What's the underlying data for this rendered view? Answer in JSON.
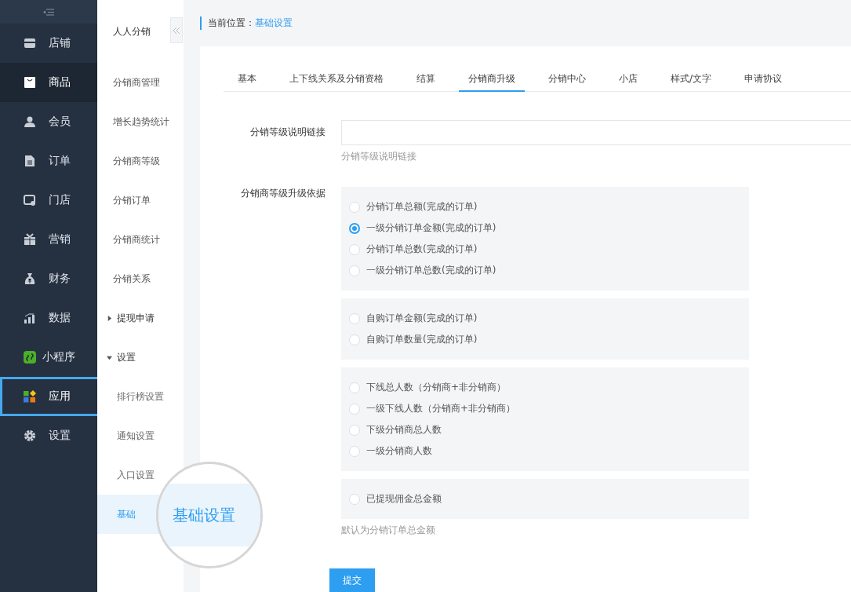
{
  "main_nav": {
    "items": [
      {
        "label": "店铺",
        "selected": false,
        "highlighted": false
      },
      {
        "label": "商品",
        "selected": true,
        "highlighted": false
      },
      {
        "label": "会员",
        "selected": false,
        "highlighted": false
      },
      {
        "label": "订单",
        "selected": false,
        "highlighted": false
      },
      {
        "label": "门店",
        "selected": false,
        "highlighted": false
      },
      {
        "label": "营销",
        "selected": false,
        "highlighted": false
      },
      {
        "label": "财务",
        "selected": false,
        "highlighted": false
      },
      {
        "label": "数据",
        "selected": false,
        "highlighted": false
      },
      {
        "label": "小程序",
        "selected": false,
        "highlighted": false
      },
      {
        "label": "应用",
        "selected": false,
        "highlighted": true
      },
      {
        "label": "设置",
        "selected": false,
        "highlighted": false
      }
    ]
  },
  "sub_nav": {
    "title": "人人分销",
    "items": [
      {
        "kind": "link",
        "label": "分销商管理",
        "selected": false
      },
      {
        "kind": "link",
        "label": "增长趋势统计",
        "selected": false
      },
      {
        "kind": "link",
        "label": "分销商等级",
        "selected": false
      },
      {
        "kind": "link",
        "label": "分销订单",
        "selected": false
      },
      {
        "kind": "link",
        "label": "分销商统计",
        "selected": false
      },
      {
        "kind": "link",
        "label": "分销关系",
        "selected": false
      },
      {
        "kind": "group",
        "label": "提现申请",
        "expanded": false
      },
      {
        "kind": "group",
        "label": "设置",
        "expanded": true,
        "children": [
          {
            "kind": "link",
            "label": "排行榜设置",
            "selected": false
          },
          {
            "kind": "link",
            "label": "通知设置",
            "selected": false
          },
          {
            "kind": "link",
            "label": "入口设置",
            "selected": false
          },
          {
            "kind": "link",
            "label": "基础",
            "selected": true
          }
        ]
      }
    ]
  },
  "magnifier": {
    "label": "基础设置"
  },
  "breadcrumb": {
    "prefix": "当前位置：",
    "current": "基础设置"
  },
  "tabs": [
    {
      "label": "基本",
      "selected": false
    },
    {
      "label": "上下线关系及分销资格",
      "selected": false
    },
    {
      "label": "结算",
      "selected": false
    },
    {
      "label": "分销商升级",
      "selected": true
    },
    {
      "label": "分销中心",
      "selected": false
    },
    {
      "label": "小店",
      "selected": false
    },
    {
      "label": "样式/文字",
      "selected": false
    },
    {
      "label": "申请协议",
      "selected": false
    }
  ],
  "link_field": {
    "label": "分销等级说明链接",
    "help": "分销等级说明链接"
  },
  "upgrade_basis": {
    "label": "分销商等级升级依据",
    "groups": [
      [
        {
          "label": "分销订单总额(完成的订单)",
          "selected": false
        },
        {
          "label": "一级分销订单金额(完成的订单)",
          "selected": true
        },
        {
          "label": "分销订单总数(完成的订单)",
          "selected": false
        },
        {
          "label": "一级分销订单总数(完成的订单)",
          "selected": false
        }
      ],
      [
        {
          "label": "自购订单金额(完成的订单)",
          "selected": false
        },
        {
          "label": "自购订单数量(完成的订单)",
          "selected": false
        }
      ],
      [
        {
          "label": "下线总人数（分销商+非分销商）",
          "selected": false
        },
        {
          "label": "一级下线人数（分销商+非分销商）",
          "selected": false
        },
        {
          "label": "下级分销商总人数",
          "selected": false
        },
        {
          "label": "一级分销商人数",
          "selected": false
        }
      ],
      [
        {
          "label": "已提现佣金总金额",
          "selected": false
        }
      ]
    ],
    "help": "默认为分销订单总金额"
  },
  "submit": "提交"
}
